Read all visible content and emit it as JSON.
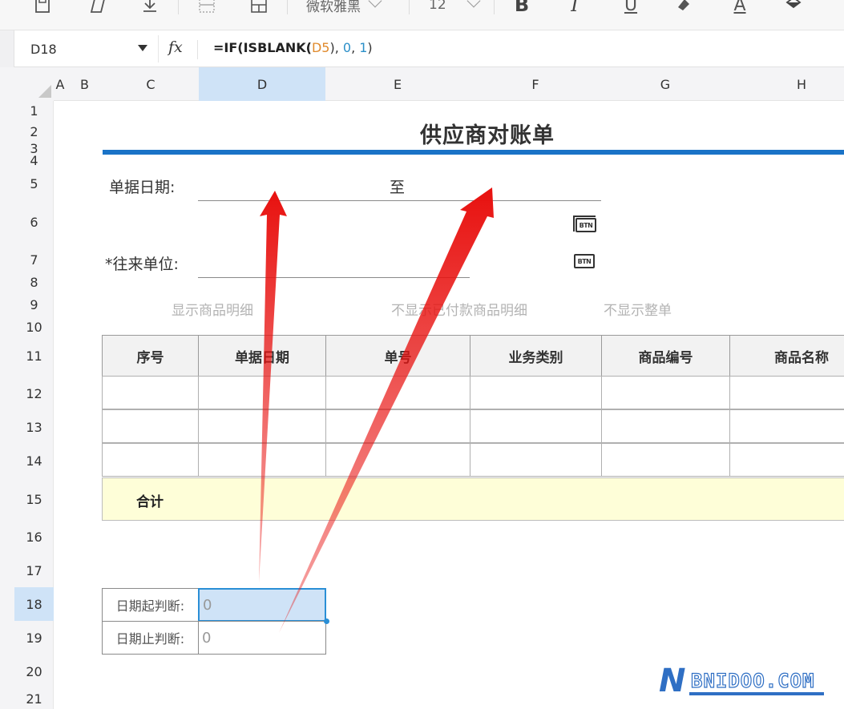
{
  "toolbar": {
    "font_name": "微软雅黑",
    "font_size": "12",
    "bold": "B",
    "italic": "I",
    "underline": "U",
    "font_color": "A"
  },
  "formula_bar": {
    "cell_ref": "D18",
    "fx": "fx",
    "formula_prefix": "=IF(ISBLANK(",
    "formula_ref": "D5",
    "formula_mid1": "), ",
    "formula_zero": "0",
    "formula_mid2": ", ",
    "formula_one": "1",
    "formula_suffix": ")"
  },
  "columns": {
    "A": "A",
    "B": "B",
    "C": "C",
    "D": "D",
    "E": "E",
    "F": "F",
    "G": "G",
    "H": "H",
    "active": "D"
  },
  "rows": [
    "1",
    "2",
    "3",
    "4",
    "5",
    "6",
    "7",
    "8",
    "9",
    "10",
    "11",
    "12",
    "13",
    "14",
    "15",
    "16",
    "17",
    "18",
    "19",
    "20",
    "21"
  ],
  "active_row": "18",
  "sheet": {
    "title": "供应商对账单",
    "date_label": "单据日期:",
    "date_to": "至",
    "partner_label": "*往来单位:",
    "btn_text": "BTN",
    "options": {
      "show_detail": "显示商品明细",
      "hide_paid": "不显示已付款商品明细",
      "hide_whole": "不显示整单"
    },
    "table": {
      "headers": [
        "序号",
        "单据日期",
        "单号",
        "业务类别",
        "商品编号",
        "商品名称"
      ],
      "total_label": "合计"
    },
    "judge": {
      "start_label": "日期起判断:",
      "start_value": "0",
      "end_label": "日期止判断:",
      "end_value": "0"
    }
  },
  "watermark": {
    "letter": "N",
    "text": "BNIDOO.COM"
  },
  "colors": {
    "accent_blue": "#1a73c7",
    "selection": "#cfe3f7",
    "total_row_bg": "#fefed8",
    "arrow_red": "#e8110f"
  },
  "icons": [
    "save-icon",
    "eraser-icon",
    "download-icon",
    "border-icon",
    "merge-icon",
    "clear-format-icon",
    "fill-color-icon"
  ]
}
